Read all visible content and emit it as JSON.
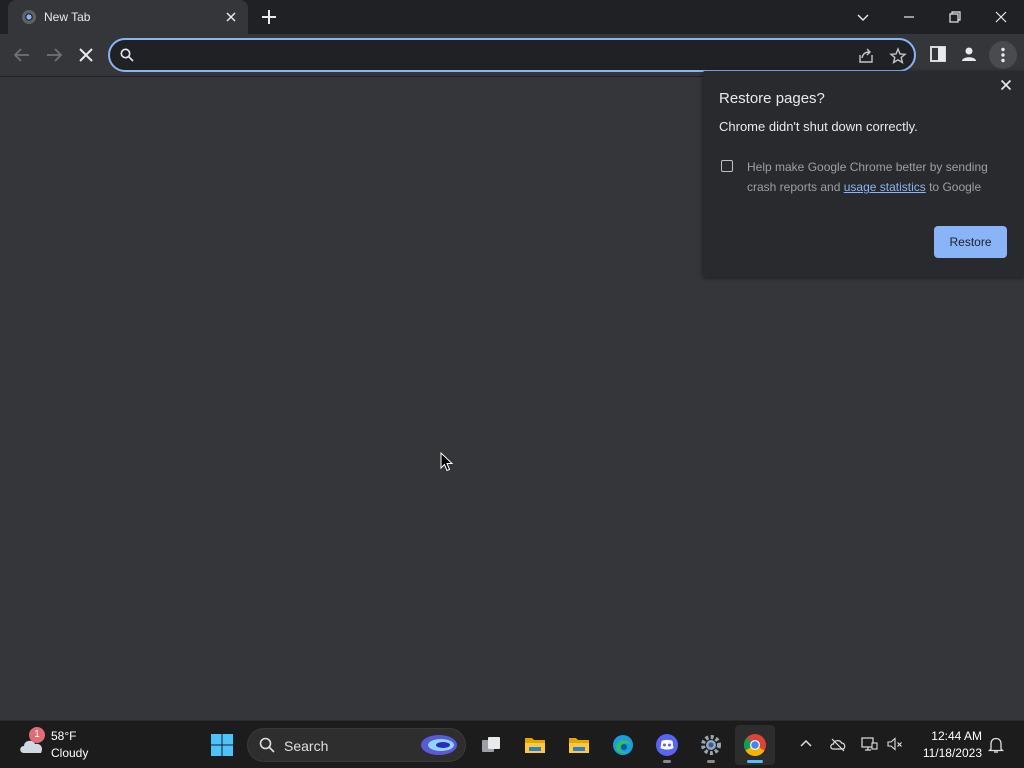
{
  "browser": {
    "tab": {
      "title": "New Tab"
    },
    "omnibox": {
      "value": "",
      "placeholder": ""
    },
    "colors": {
      "frame": "#202124",
      "toolbar": "#35363a",
      "accent": "#8ab4f8"
    }
  },
  "restore_bubble": {
    "title": "Restore pages?",
    "message": "Chrome didn't shut down correctly.",
    "consent_prefix": "Help make Google Chrome better by sending crash reports and ",
    "consent_link": "usage statistics",
    "consent_suffix": " to Google",
    "checkbox_checked": false,
    "restore_label": "Restore"
  },
  "taskbar": {
    "weather": {
      "badge": "1",
      "temp": "58°F",
      "condition": "Cloudy"
    },
    "search": {
      "label": "Search"
    },
    "apps": [
      {
        "name": "task-view",
        "icon": "task-view-icon"
      },
      {
        "name": "file-explorer",
        "icon": "folder-icon"
      },
      {
        "name": "file-explorer-2",
        "icon": "folder-icon"
      },
      {
        "name": "edge",
        "icon": "edge-icon"
      },
      {
        "name": "discord",
        "icon": "discord-icon"
      },
      {
        "name": "settings",
        "icon": "gear-icon"
      },
      {
        "name": "chrome",
        "icon": "chrome-icon",
        "active": true
      }
    ],
    "clock": {
      "time": "12:44 AM",
      "date": "11/18/2023"
    }
  }
}
